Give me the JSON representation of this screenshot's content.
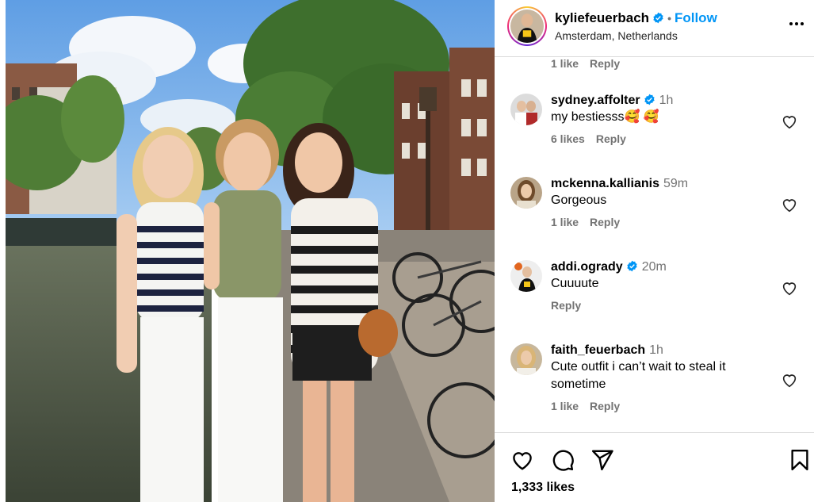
{
  "header": {
    "username": "kyliefeuerbach",
    "follow_label": "Follow",
    "separator": "•",
    "location": "Amsterdam, Netherlands",
    "icons": {
      "verified": "verified-badge-icon",
      "more": "more-options-icon"
    }
  },
  "comments": {
    "top_meta": {
      "likes": "1 like",
      "reply": "Reply"
    },
    "items": [
      {
        "username": "sydney.affolter",
        "verified": true,
        "time": "1h",
        "text": "my bestiesss🥰 🥰",
        "likes": "6 likes",
        "reply": "Reply"
      },
      {
        "username": "mckenna.kallianis",
        "verified": false,
        "time": "59m",
        "text": "Gorgeous",
        "likes": "1 like",
        "reply": "Reply"
      },
      {
        "username": "addi.ogrady",
        "verified": true,
        "time": "20m",
        "text": "Cuuuute",
        "likes": "",
        "reply": "Reply"
      },
      {
        "username": "faith_feuerbach",
        "verified": false,
        "time": "1h",
        "text": "Cute outfit i can’t wait to steal it sometime",
        "likes": "1 like",
        "reply": "Reply"
      }
    ]
  },
  "actions": {
    "icons": [
      "heart-icon",
      "comment-icon",
      "share-icon",
      "bookmark-icon"
    ],
    "likes_count": "1,333 likes"
  },
  "colors": {
    "accent": "#0095f6",
    "verified": "#0095f6",
    "muted": "#737373"
  }
}
